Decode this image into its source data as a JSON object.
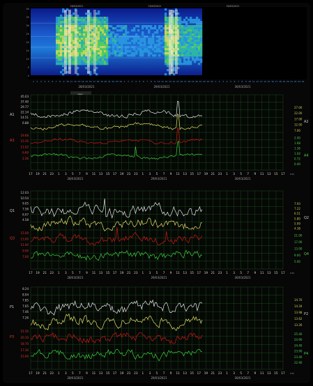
{
  "spectrogram": {
    "y_ticks": [
      "0",
      "5",
      "10",
      "15",
      "20",
      "25",
      "30",
      "35",
      "40"
    ],
    "top_dates": [
      "28/03/2021",
      "29/03/2021",
      "30/03/2021"
    ],
    "bottom_date_a": "28/03/2021",
    "bottom_date_b": "29/03/2021",
    "bottom_date_c": "30/03/2021",
    "hours": [
      "1",
      "2",
      "3",
      "4",
      "5",
      "6",
      "7",
      "8",
      "9",
      "10",
      "11",
      "12",
      "13",
      "14",
      "15",
      "16",
      "17",
      "18",
      "19",
      "20",
      "21",
      "22",
      "23",
      "24",
      "1",
      "2",
      "3",
      "4",
      "5",
      "6",
      "7",
      "8",
      "9",
      "10",
      "11",
      "12",
      "13",
      "14",
      "15",
      "16",
      "17",
      "18",
      "19",
      "20",
      "21",
      "22",
      "23",
      "24",
      "1",
      "2",
      "3",
      "4",
      "5",
      "6",
      "7",
      "8",
      "9",
      "10",
      "11",
      "12",
      "13",
      "14",
      "15",
      "16",
      "17",
      "18",
      "19",
      "20",
      "21",
      "22",
      "23",
      "24"
    ]
  },
  "panels": [
    {
      "id": "panel-1",
      "dates": [
        "28/03/2021",
        "29/03/2021",
        "30/03/2021"
      ],
      "labels_left_primary": [
        "A1"
      ],
      "labels_left_secondary": [
        "A3"
      ],
      "labels_right_primary": [
        "A2"
      ],
      "labels_right_secondary": [
        "A4"
      ],
      "ticks_left_white": [
        "45.03",
        "37.40",
        "29.77",
        "22.14",
        "14.51",
        "6.88"
      ],
      "ticks_left_red": [
        "19.68",
        "15.35",
        "11.02",
        "6.69",
        "2.36"
      ],
      "ticks_right_yellow": [
        "27.00",
        "22.00",
        "17.00",
        "12.00",
        "7.00"
      ],
      "ticks_right_green": [
        "2.00",
        "1.68",
        "1.36",
        "1.04",
        "0.72",
        "0.40"
      ],
      "hours": [
        "17",
        "19",
        "21",
        "23",
        "1",
        "3",
        "5",
        "7",
        "9",
        "11",
        "13",
        "15",
        "17",
        "19",
        "21",
        "23",
        "1",
        "3",
        "5",
        "7",
        "9",
        "11",
        "13",
        "15",
        "17",
        "19",
        "21",
        "23",
        "1",
        "3",
        "5",
        "7",
        "9",
        "11",
        "13",
        "15",
        "17"
      ]
    },
    {
      "id": "panel-2",
      "dates": [
        "28/03/2021",
        "29/03/2021",
        "30/03/2021"
      ],
      "labels_left_primary": [
        "Q1"
      ],
      "labels_left_secondary": [
        "Q3"
      ],
      "labels_right_primary": [
        "Q2"
      ],
      "labels_right_secondary": [
        "Q4"
      ],
      "ticks_left_white": [
        "12.03",
        "10.54",
        "9.05",
        "7.56",
        "6.07",
        "4.58"
      ],
      "ticks_left_red": [
        "15.00",
        "13.00",
        "11.00",
        "9.00",
        "7.00"
      ],
      "ticks_right_yellow": [
        "7.93",
        "7.22",
        "6.51",
        "5.80",
        "5.09",
        "4.38"
      ],
      "ticks_right_green": [
        "21.00",
        "17.00",
        "13.00",
        "9.00",
        "5.00"
      ],
      "hours": [
        "17",
        "19",
        "21",
        "23",
        "1",
        "3",
        "5",
        "7",
        "9",
        "11",
        "13",
        "15",
        "17",
        "19",
        "21",
        "23",
        "1",
        "3",
        "5",
        "7",
        "9",
        "11",
        "13",
        "15",
        "17",
        "19",
        "21",
        "23",
        "1",
        "3",
        "5",
        "7",
        "9",
        "11",
        "13",
        "15",
        "17"
      ]
    },
    {
      "id": "panel-3",
      "dates": [
        "28/03/2021",
        "29/03/2021",
        "30/03/2021"
      ],
      "labels_left_primary": [
        "P1"
      ],
      "labels_left_secondary": [
        "P3"
      ],
      "labels_right_primary": [
        "P2"
      ],
      "labels_right_secondary": [
        "P4"
      ],
      "ticks_left_white": [
        "8.24",
        "8.04",
        "7.85",
        "7.65",
        "7.46",
        "7.26"
      ],
      "ticks_left_red": [
        "21.50",
        "20.10",
        "18.70",
        "17.30",
        "15.90"
      ],
      "ticks_right_yellow": [
        "14.70",
        "14.34",
        "13.98",
        "13.62",
        "13.26"
      ],
      "ticks_right_green": [
        "25.40",
        "24.90",
        "24.40",
        "23.90",
        "23.40",
        "22.90"
      ],
      "hours": [
        "17",
        "19",
        "21",
        "23",
        "1",
        "3",
        "5",
        "7",
        "9",
        "11",
        "13",
        "15",
        "17",
        "19",
        "21",
        "23",
        "1",
        "3",
        "5",
        "7",
        "9",
        "11",
        "13",
        "15",
        "17",
        "19",
        "21",
        "23",
        "1",
        "3",
        "5",
        "7",
        "9",
        "11",
        "13",
        "15",
        "17"
      ]
    }
  ],
  "colors": {
    "white_series": "#e8e8e8",
    "yellow_series": "#e6e06a",
    "red_series": "#d01818",
    "green_series": "#3fcf3f",
    "grid": "#1f5a1f",
    "axis_text_left": "#cfcfcf",
    "axis_text_right": "#cfcf60",
    "tick_red": "#e03a2a",
    "tick_green": "#4fd04f"
  }
}
